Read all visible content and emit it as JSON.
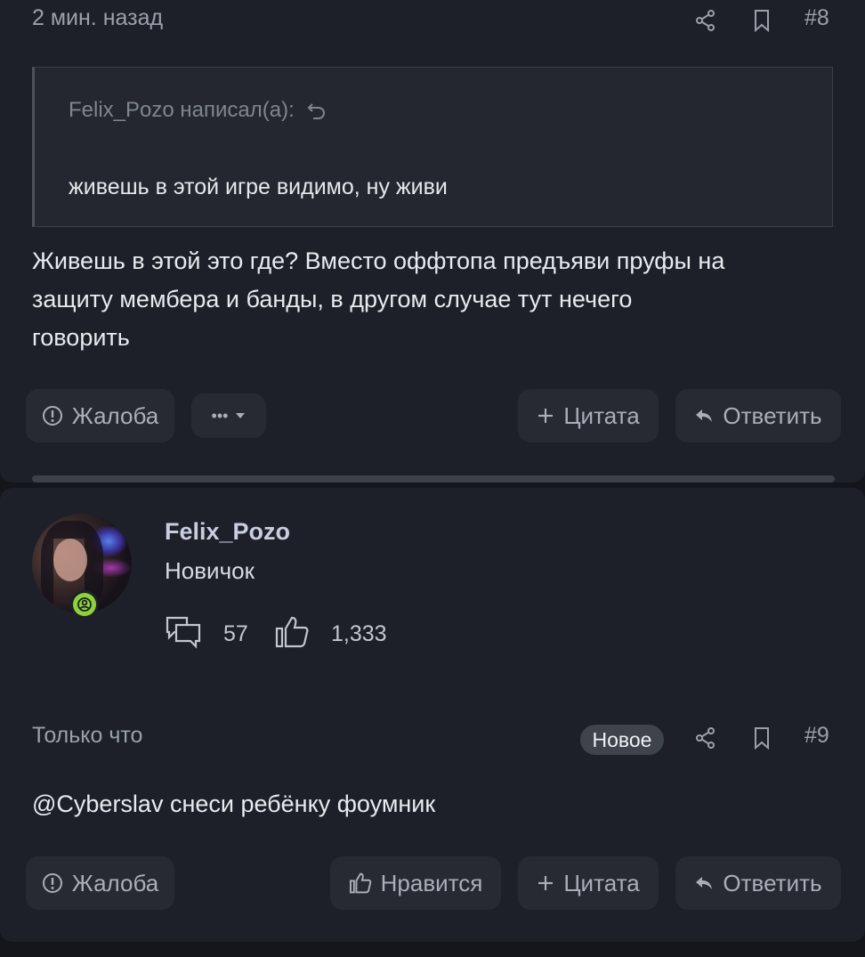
{
  "post1": {
    "time": "2 мин. назад",
    "number": "#8",
    "quote": {
      "author": "Felix_Pozo написал(а):",
      "text": "живешь в этой игре видимо, ну живи"
    },
    "body_lines": [
      "Живешь в этой это где? Вместо оффтопа предъяви пруфы на",
      "защиту мембера и банды, в другом случае тут нечего",
      "говорить"
    ],
    "buttons": {
      "report": "Жалоба",
      "more": "•••",
      "quote": "Цитата",
      "reply": "Ответить"
    }
  },
  "author": {
    "username": "Felix_Pozo",
    "rank": "Новичок",
    "messages": "57",
    "likes": "1,333"
  },
  "post2": {
    "time": "Только что",
    "new_badge": "Новое",
    "number": "#9",
    "body": "@Cyberslav снеси ребёнку фоумник",
    "buttons": {
      "report": "Жалоба",
      "like": "Нравится",
      "quote": "Цитата",
      "reply": "Ответить"
    }
  },
  "colors": {
    "background": "#14161c",
    "card": "#1d2028",
    "button": "#272a33",
    "username": "#c8cde0",
    "badge_green": "#8ed23a"
  }
}
